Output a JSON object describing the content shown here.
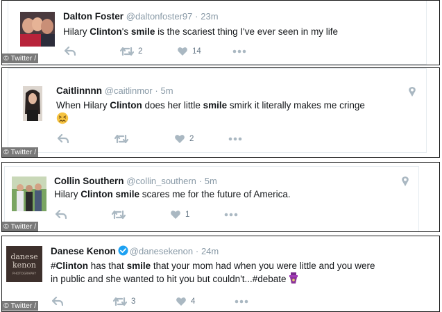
{
  "credit": "© Twitter /",
  "colors": {
    "text": "#14171a",
    "muted": "#8899a6",
    "action": "#aab8c2",
    "verified": "#1da1f2"
  },
  "tweets": [
    {
      "name": "Dalton Foster",
      "handle": "@daltonfoster97",
      "sep": "·",
      "time": "23m",
      "text": [
        {
          "t": "Hilary ",
          "b": false
        },
        {
          "t": "Clinton",
          "b": true
        },
        {
          "t": "'s ",
          "b": false
        },
        {
          "t": "smile",
          "b": true
        },
        {
          "t": " is the scariest thing I've ever seen in my life",
          "b": false
        }
      ],
      "retweets": "2",
      "likes": "14"
    },
    {
      "name": "Caitlinnnn",
      "handle": "@caitlinmor",
      "sep": "·",
      "time": "5m",
      "text": [
        {
          "t": "When Hilary ",
          "b": false
        },
        {
          "t": "Clinton",
          "b": true
        },
        {
          "t": " does her little ",
          "b": false
        },
        {
          "t": "smile",
          "b": true
        },
        {
          "t": " smirk it literally makes me cringe",
          "b": false
        }
      ],
      "emoji": "confounded-face",
      "retweets": "",
      "likes": "2"
    },
    {
      "name": "Collin Southern",
      "handle": "@collin_southern",
      "sep": "·",
      "time": "5m",
      "text": [
        {
          "t": "Hilary ",
          "b": false
        },
        {
          "t": "Clinton smile",
          "b": true
        },
        {
          "t": " scares me for the future of America.",
          "b": false
        }
      ],
      "retweets": "",
      "likes": "1"
    },
    {
      "name": "Danese Kenon",
      "handle": "@danesekenon",
      "sep": "·",
      "time": "24m",
      "verified": true,
      "avatar_text": {
        "line1": "danese",
        "line2": "kenon",
        "line3": "PHOTOGRAPHY"
      },
      "text_line1": [
        {
          "t": "#",
          "b": false
        },
        {
          "t": "Clinton",
          "b": true
        },
        {
          "t": " has that ",
          "b": false
        },
        {
          "t": "smile",
          "b": true
        },
        {
          "t": " that your mom had when you were little and you were",
          "b": false
        }
      ],
      "text_line2": "in public and she wanted to hit you but couldn't...#debate",
      "retweets": "3",
      "likes": "4"
    }
  ]
}
